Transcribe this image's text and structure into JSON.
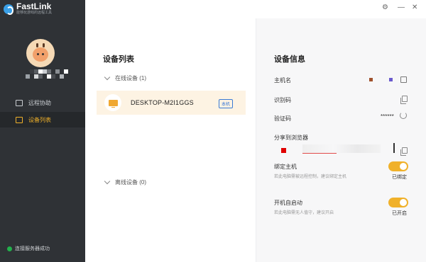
{
  "app": {
    "name": "FastLink",
    "tagline": "能够玩游戏的远程工具"
  },
  "sidebar": {
    "items": [
      {
        "label": "远程协助"
      },
      {
        "label": "设备列表"
      }
    ],
    "status_text": "连接服务器成功"
  },
  "device_list": {
    "title": "设备列表",
    "online_group": "在线设备 (1)",
    "offline_group": "离线设备 (0)",
    "devices": [
      {
        "name": "DESKTOP-M2I1GGS",
        "tag": "本机"
      }
    ]
  },
  "device_info": {
    "title": "设备信息",
    "hostname_label": "主机名",
    "id_label": "识别码",
    "verify_label": "验证码",
    "verify_value": "******",
    "share_label": "分享到浏览器",
    "bind_label": "绑定主机",
    "bind_desc": "若此电脑需被远程控制，建议绑定主机",
    "bind_state": "已绑定",
    "autostart_label": "开机自启动",
    "autostart_desc": "若此电脑需无人值守，建议开启",
    "autostart_state": "已开启"
  },
  "colors": {
    "sidebar_bg": "#2f3236",
    "accent": "#f0b12a",
    "status_ok": "#22b14c",
    "brand_blue": "#3aa0e8"
  },
  "icons": [
    "fastlink-logo-icon",
    "settings-icon",
    "minimize-icon",
    "close-icon",
    "assist-icon",
    "device-list-icon",
    "monitor-icon",
    "chevron-down-icon",
    "edit-icon",
    "copy-icon",
    "refresh-icon"
  ]
}
